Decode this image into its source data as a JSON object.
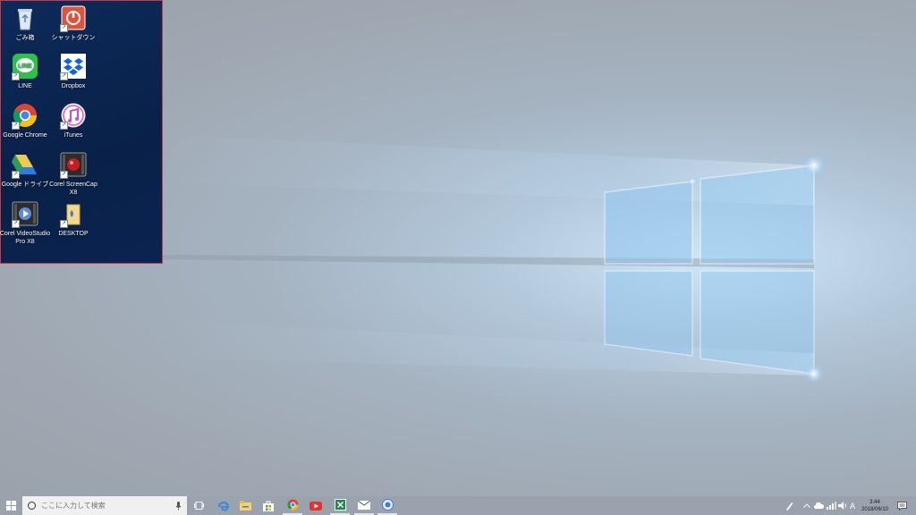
{
  "desktop": {
    "icons": [
      {
        "label": "ごみ箱",
        "icon": "recycle-bin-icon"
      },
      {
        "label": "シャットダウン",
        "icon": "shutdown-icon"
      },
      {
        "label": "LINE",
        "icon": "line-app-icon",
        "inner": "LINE"
      },
      {
        "label": "Dropbox",
        "icon": "dropbox-icon"
      },
      {
        "label": "Google Chrome",
        "icon": "chrome-icon"
      },
      {
        "label": "iTunes",
        "icon": "itunes-icon"
      },
      {
        "label": "Google ドライブ",
        "icon": "google-drive-icon"
      },
      {
        "label": "Corel ScreenCap X8",
        "icon": "corel-screencap-icon"
      },
      {
        "label": "Corel VideoStudio Pro X8",
        "icon": "corel-videostudio-icon"
      },
      {
        "label": "DESKTOP",
        "icon": "desktop-folder-icon"
      }
    ]
  },
  "taskbar": {
    "search_placeholder": "ここに入力して検索",
    "pinned": [
      "task-view-icon",
      "edge-icon",
      "file-explorer-icon",
      "store-icon",
      "chrome-icon",
      "youtube-icon",
      "excel-icon",
      "mail-icon",
      "app-icon"
    ],
    "tray": {
      "ime": "A",
      "time": "3:44",
      "date": "2018/06/10"
    }
  },
  "colors": {
    "panel_border": "#c8374a",
    "taskbar": "#9aa3ad"
  }
}
